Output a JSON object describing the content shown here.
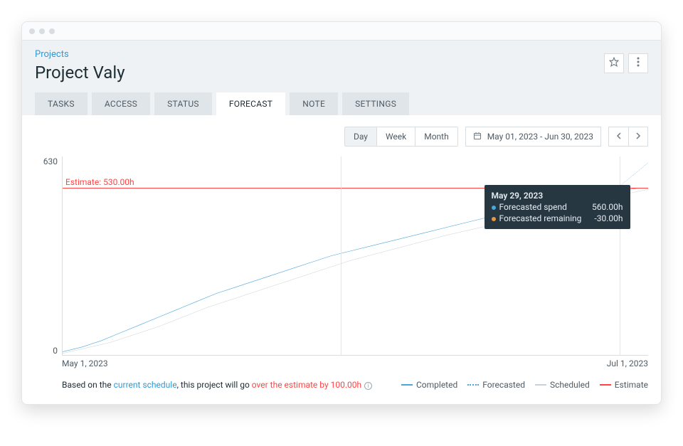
{
  "breadcrumb": "Projects",
  "title": "Project Valy",
  "tabs": [
    {
      "label": "TASKS"
    },
    {
      "label": "ACCESS"
    },
    {
      "label": "STATUS"
    },
    {
      "label": "FORECAST",
      "active": true
    },
    {
      "label": "NOTE"
    },
    {
      "label": "SETTINGS"
    }
  ],
  "granularity": [
    {
      "label": "Day",
      "active": true
    },
    {
      "label": "Week"
    },
    {
      "label": "Month"
    }
  ],
  "date_range": "May 01, 2023 - Jun 30, 2023",
  "y_max_label": "630",
  "y_min_label": "0",
  "estimate_label": "Estimate: 530.00h",
  "x_start": "May 1, 2023",
  "x_end": "Jul 1, 2023",
  "footer_msg": {
    "prefix": "Based on the ",
    "link": "current schedule",
    "mid": ", this project will go ",
    "over": "over the estimate by 100.00h"
  },
  "legend": {
    "completed": "Completed",
    "forecasted": "Forecasted",
    "scheduled": "Scheduled",
    "estimate": "Estimate"
  },
  "tooltip": {
    "date": "May 29, 2023",
    "rows": [
      {
        "label": "Forecasted spend",
        "value": "560.00h",
        "color": "#49a7db"
      },
      {
        "label": "Forecasted remaining",
        "value": "-30.00h",
        "color": "#e59a3c"
      }
    ]
  },
  "chart_data": {
    "type": "line",
    "xlabel": "",
    "ylabel": "",
    "x_range": [
      "May 1, 2023",
      "Jul 1, 2023"
    ],
    "ylim": [
      0,
      630
    ],
    "estimate": 530,
    "series": [
      {
        "name": "Completed",
        "color": "#49a7db",
        "style": "solid",
        "x_days": [
          0,
          2,
          4,
          6,
          8,
          10,
          12,
          14,
          16,
          18,
          20,
          22,
          24,
          26,
          28,
          30,
          32,
          34,
          36,
          38,
          40,
          42,
          44,
          46,
          48,
          50,
          51,
          52,
          53,
          54,
          55,
          56,
          57,
          58,
          59,
          60,
          61
        ],
        "values": [
          10,
          25,
          45,
          70,
          95,
          120,
          145,
          170,
          195,
          215,
          235,
          255,
          275,
          295,
          315,
          330,
          345,
          360,
          375,
          390,
          405,
          420,
          435,
          450,
          460,
          475,
          482,
          490,
          500,
          505,
          508,
          512,
          515,
          520,
          525,
          530,
          530
        ]
      },
      {
        "name": "Forecasted",
        "color": "#49a7db",
        "style": "dotted",
        "x_days": [
          57,
          58,
          59,
          60,
          61
        ],
        "values": [
          515,
          535,
          560,
          585,
          610
        ]
      },
      {
        "name": "Scheduled",
        "color": "#c9d1d7",
        "style": "solid",
        "x_days": [
          0,
          5,
          10,
          15,
          20,
          25,
          30,
          35,
          40,
          45,
          50,
          55,
          58,
          60,
          61
        ],
        "values": [
          5,
          40,
          90,
          150,
          200,
          250,
          300,
          340,
          380,
          415,
          450,
          485,
          505,
          520,
          525
        ]
      },
      {
        "name": "Estimate",
        "color": "#f44",
        "style": "solid",
        "x_days": [
          0,
          61
        ],
        "values": [
          530,
          530
        ]
      }
    ],
    "tooltip_point_day": 58,
    "vline_days": [
      29,
      58
    ]
  }
}
